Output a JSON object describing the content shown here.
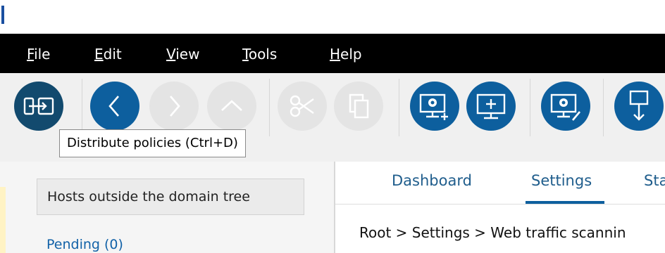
{
  "menu": [
    {
      "mnemonic": "F",
      "rest": "ile"
    },
    {
      "mnemonic": "E",
      "rest": "dit"
    },
    {
      "mnemonic": "V",
      "rest": "iew"
    },
    {
      "mnemonic": "T",
      "rest": "ools"
    },
    {
      "mnemonic": "H",
      "rest": "elp"
    }
  ],
  "toolbar": {
    "icons": [
      "distribute-policies-icon",
      "back-icon",
      "forward-icon",
      "up-icon",
      "cut-icon",
      "copy-icon",
      "add-computer-settings-icon",
      "add-computer-icon",
      "computer-settings-icon",
      "deploy-icon"
    ],
    "colors": {
      "dark": "#124a6e",
      "blue": "#0d5f9e",
      "disabled": "#e4e4e4"
    }
  },
  "tooltip": {
    "text": "Distribute policies (Ctrl+D)"
  },
  "left_panel": {
    "host_group": "Hosts outside the domain tree",
    "pending": "Pending (0)"
  },
  "tabs": {
    "dashboard": "Dashboard",
    "settings": "Settings",
    "partial": "Sta",
    "active": "Settings"
  },
  "breadcrumb": "Root > Settings > Web traffic scannin"
}
